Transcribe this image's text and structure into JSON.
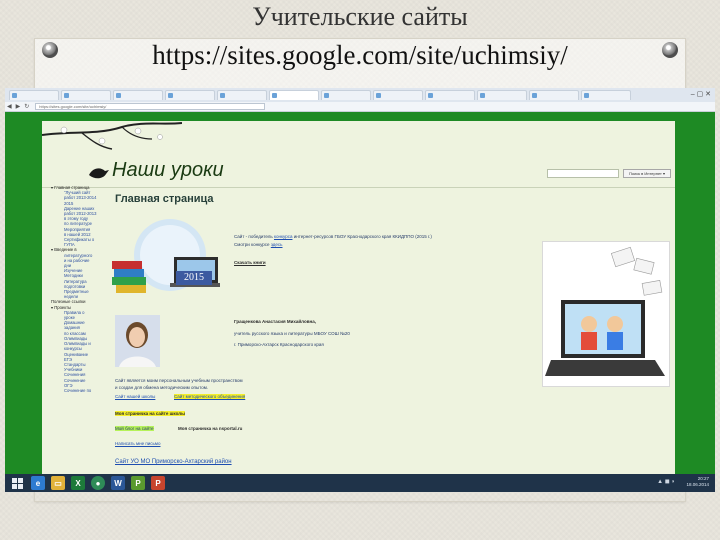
{
  "slide": {
    "title": "Учительские сайты",
    "url": "https://sites.google.com/site/uchimsiy/"
  },
  "browser": {
    "address_bar": "https://sites.google.com/site/uchimsiy/",
    "tab_count": 16,
    "active_tab_index": 6,
    "window_controls": "– ▢ ✕"
  },
  "site": {
    "title": "Наши уроки",
    "search_button": "Поиск в Интернет ▾",
    "main_heading": "Главная страница",
    "badge_year": "2015",
    "award_line1_prefix": "Сайт - победитель ",
    "award_line1_link": "конкурса",
    "award_line1_suffix": " интернет-ресурсов ГБОУ Краснодарского края ККИДППО (2015 г.)",
    "award_line2_prefix": "Смотри конкурсе ",
    "award_line2_link": "здесь",
    "download_link": "Скачать книги",
    "teacher_name": "Гращенкова Анастасия Михайловна,",
    "teacher_role": "учитель русского языка и литературы МБОУ СОШ №20",
    "teacher_place": "г. Приморско-Ахтарск Краснодарского края",
    "intro_text1": "Сайт является моим персональным учебным пространством",
    "intro_text2": "и создан для обмена методическим опытом.",
    "link_my_site": "Сайт нашей школы",
    "link_right": "Сайт методического объединения",
    "page_school": "Моя страничка на сайте школы",
    "page_left2": "Мой блог на сайте",
    "page_right2": "Моя страничка на nsportal.ru",
    "page_mail": "Написать мне письмо",
    "footer_line": "Сайт УО МО Приморско-Ахтарский район"
  },
  "sidebar": {
    "items": [
      {
        "level": 1,
        "label": "▾ Главная страница"
      },
      {
        "level": 2,
        "label": "\"Лучший сайт"
      },
      {
        "level": 2,
        "label": "работ 2013-2014"
      },
      {
        "level": 2,
        "label": "2015"
      },
      {
        "level": 2,
        "label": "Дарение наших"
      },
      {
        "level": 2,
        "label": "работ 2012-2013"
      },
      {
        "level": 2,
        "label": "в этому году"
      },
      {
        "level": 2,
        "label": "по литературе"
      },
      {
        "level": 2,
        "label": "Мероприятия"
      },
      {
        "level": 2,
        "label": "в нашей 2012"
      },
      {
        "level": 2,
        "label": "Сертификаты о"
      },
      {
        "level": 2,
        "label": "ГУПА"
      },
      {
        "level": 1,
        "label": "▾ Введение в"
      },
      {
        "level": 2,
        "label": "литературного"
      },
      {
        "level": 2,
        "label": "и на рабочие"
      },
      {
        "level": 2,
        "label": "дни"
      },
      {
        "level": 2,
        "label": "Изучение"
      },
      {
        "level": 2,
        "label": "Методики"
      },
      {
        "level": 2,
        "label": "Литература"
      },
      {
        "level": 2,
        "label": "подготовки"
      },
      {
        "level": 2,
        "label": "Предметные"
      },
      {
        "level": 2,
        "label": "недели"
      },
      {
        "level": 1,
        "label": "Полезные ссылки"
      },
      {
        "level": 1,
        "label": "▾ Проекты"
      },
      {
        "level": 2,
        "label": "Правила о"
      },
      {
        "level": 2,
        "label": "уроке"
      },
      {
        "level": 2,
        "label": "Домашние"
      },
      {
        "level": 2,
        "label": "задания"
      },
      {
        "level": 2,
        "label": "по классам"
      },
      {
        "level": 2,
        "label": "Олимпиады"
      },
      {
        "level": 2,
        "label": "Олимпиады и"
      },
      {
        "level": 2,
        "label": "конкурсы"
      },
      {
        "level": 2,
        "label": "Оценивание"
      },
      {
        "level": 2,
        "label": "ЕГЭ"
      },
      {
        "level": 2,
        "label": "Стандарты"
      },
      {
        "level": 2,
        "label": "Учебники"
      },
      {
        "level": 2,
        "label": "Сочинения"
      },
      {
        "level": 2,
        "label": "Сочинение"
      },
      {
        "level": 2,
        "label": "ОГЭ"
      },
      {
        "level": 2,
        "label": "Сочинение по"
      }
    ]
  },
  "taskbar": {
    "apps": [
      "IE",
      "Folder",
      "Excel",
      "Chrome",
      "Word",
      "Pages",
      "PowerPoint"
    ],
    "tray_time": "20:27",
    "tray_date": "18.06.2014"
  },
  "colors": {
    "browser_green": "#1e8a24",
    "page_bg": "#eef3df",
    "taskbar": "#1f3349",
    "highlight_yellow": "#f5ef2a",
    "highlight_green": "#b6f25a"
  }
}
